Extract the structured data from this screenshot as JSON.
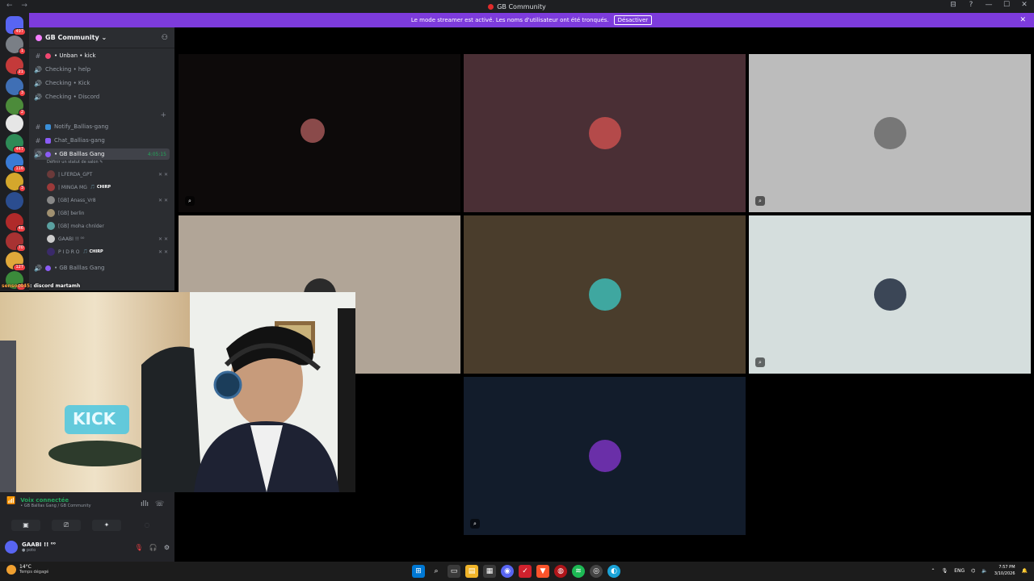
{
  "window": {
    "title": "GB Community",
    "nav_label": "← →",
    "ctrl_icons": [
      "⊟",
      "?",
      "—",
      "☐",
      "✕"
    ]
  },
  "banner": {
    "text": "Le mode streamer est activé. Les noms d'utilisateur ont été tronqués.",
    "button": "Désactiver",
    "close": "✕"
  },
  "rail": {
    "badges": [
      "497",
      "1",
      "21",
      "3",
      "2",
      "447",
      "116",
      "3",
      "46",
      "70",
      "127",
      "26"
    ]
  },
  "guild": {
    "name": "GB Community ⌄",
    "channels": [
      {
        "icon": "#",
        "label": "• Unban • kick"
      },
      {
        "icon": "🔊",
        "label": "Checking • help"
      },
      {
        "icon": "🔊",
        "label": "Checking • Kick"
      },
      {
        "icon": "🔊",
        "label": "Checking • Discord"
      },
      {
        "icon": "#",
        "label": "Notify_Ballias-gang"
      },
      {
        "icon": "#",
        "label": "Chat_Ballias-gang"
      },
      {
        "icon": "🔊",
        "label": "• GB Balllas Gang",
        "timer": "4:05:15"
      }
    ],
    "voice_status": "Définir un statut de salon ✎",
    "voice_users": [
      {
        "name": "| LFERDA_GPT",
        "tag": ""
      },
      {
        "name": "| MINGA MG",
        "tag": "🎵 CHIRP"
      },
      {
        "name": "[GB] Anass_Vr8",
        "tag": ""
      },
      {
        "name": "[GB] berlin",
        "tag": ""
      },
      {
        "name": "[GB] moha chnlder",
        "tag": ""
      },
      {
        "name": "GAABI !! ⁰⁰",
        "tag": ""
      },
      {
        "name": "P I D R O",
        "tag": "🎵 CHIRP"
      }
    ],
    "last_channel": {
      "icon": "🔊",
      "label": "• GB Balllas Gang"
    }
  },
  "chat_overlay": {
    "user": "sensor445",
    "message": ": discord martamh"
  },
  "voice_panel": {
    "status": "Voix connectée",
    "location": "• GB Balllas Gang / GB Community"
  },
  "user_panel": {
    "name": "GAABI !! ⁰⁰",
    "status": "● poto"
  },
  "taskbar": {
    "temperature": "14°C",
    "weather": "Temps dégagé",
    "lang": "ENG",
    "time": "7:57 PM",
    "date": "3/10/2026"
  },
  "colors": {
    "accent": "#7d3bdc",
    "online": "#23a55a",
    "danger": "#f23f43"
  }
}
